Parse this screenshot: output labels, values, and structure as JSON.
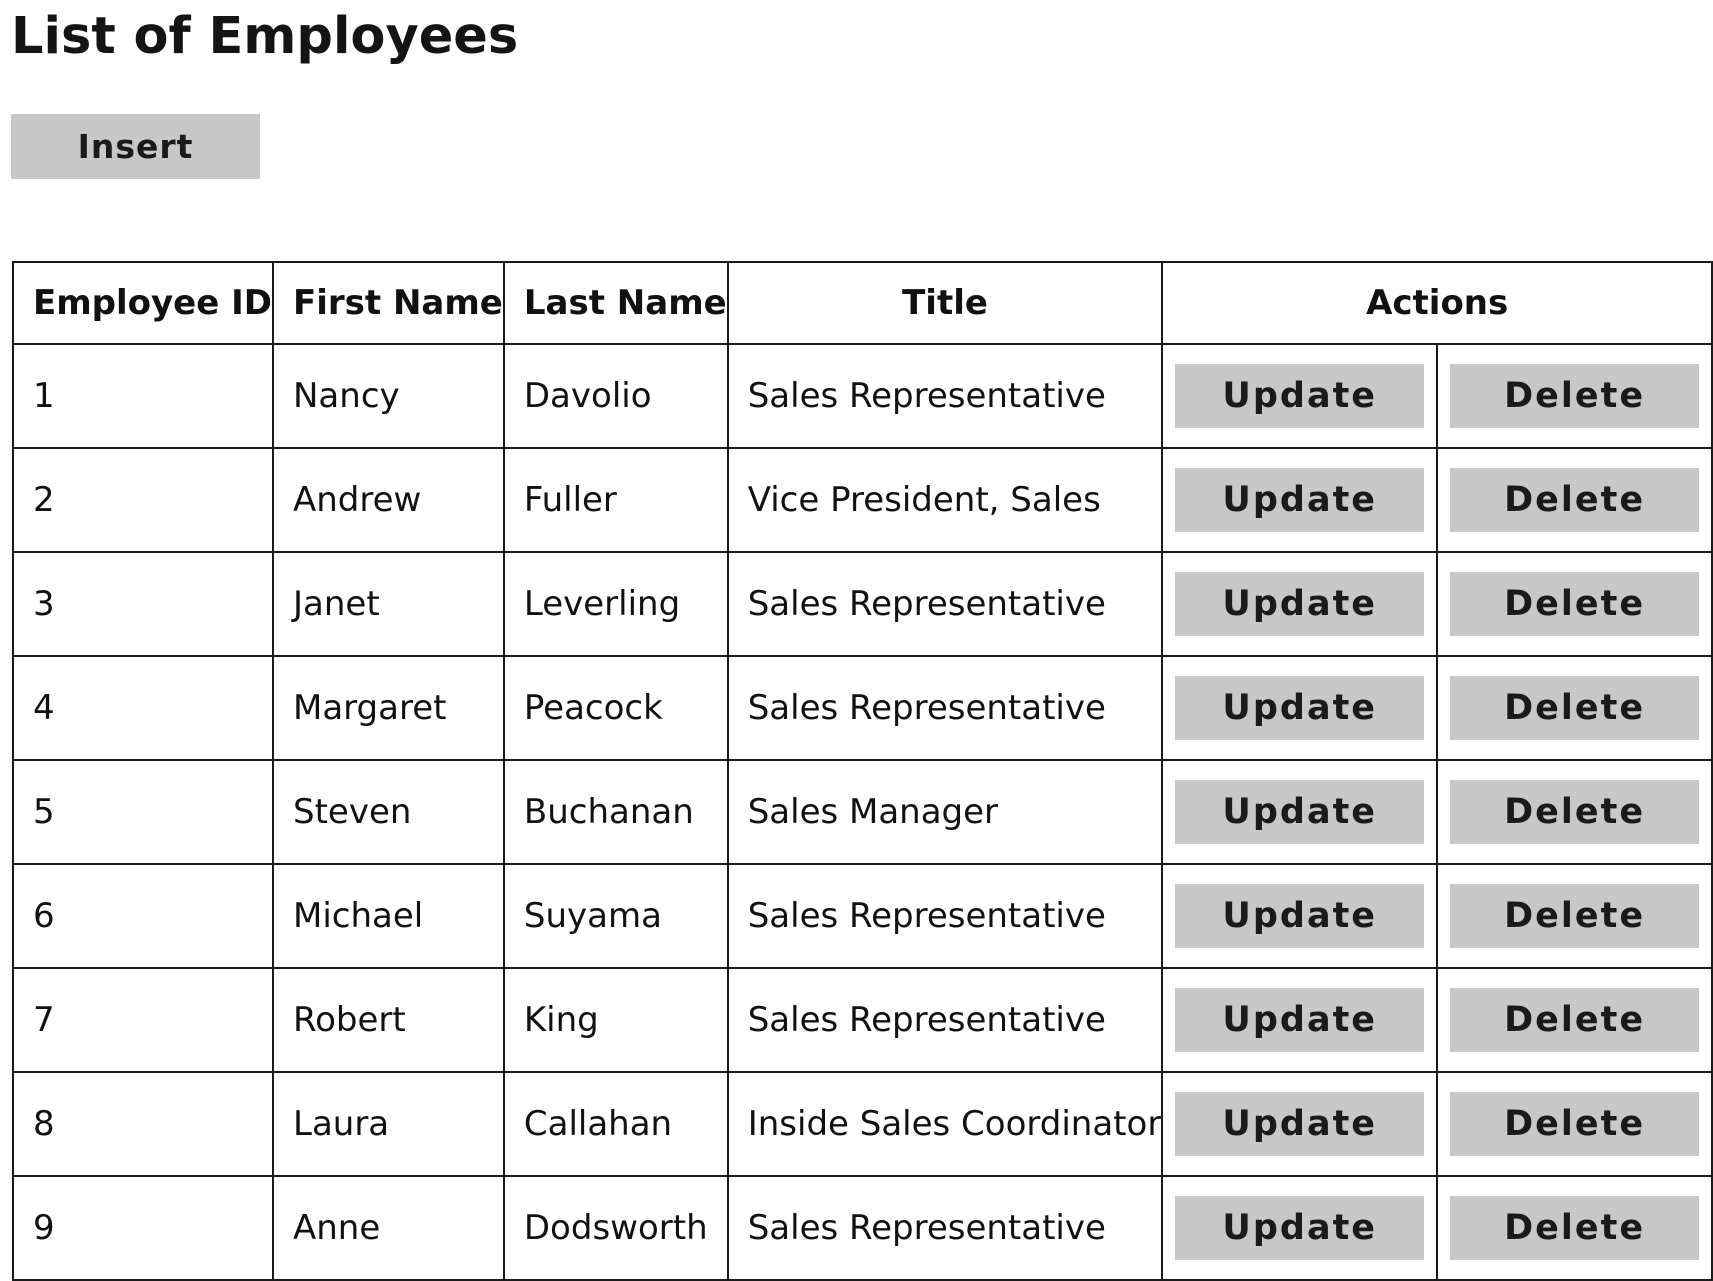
{
  "page": {
    "title": "List of Employees",
    "insert_label": "Insert"
  },
  "table": {
    "headers": {
      "employee_id": "Employee ID",
      "first_name": "First Name",
      "last_name": "Last Name",
      "title": "Title",
      "actions": "Actions"
    },
    "update_label": "Update",
    "delete_label": "Delete",
    "rows": [
      {
        "id": "1",
        "first": "Nancy",
        "last": "Davolio",
        "title": "Sales Representative"
      },
      {
        "id": "2",
        "first": "Andrew",
        "last": "Fuller",
        "title": "Vice President, Sales"
      },
      {
        "id": "3",
        "first": "Janet",
        "last": "Leverling",
        "title": "Sales Representative"
      },
      {
        "id": "4",
        "first": "Margaret",
        "last": "Peacock",
        "title": "Sales Representative"
      },
      {
        "id": "5",
        "first": "Steven",
        "last": "Buchanan",
        "title": "Sales Manager"
      },
      {
        "id": "6",
        "first": "Michael",
        "last": "Suyama",
        "title": "Sales Representative"
      },
      {
        "id": "7",
        "first": "Robert",
        "last": "King",
        "title": "Sales Representative"
      },
      {
        "id": "8",
        "first": "Laura",
        "last": "Callahan",
        "title": "Inside Sales Coordinator"
      },
      {
        "id": "9",
        "first": "Anne",
        "last": "Dodsworth",
        "title": "Sales Representative"
      }
    ]
  },
  "colors": {
    "button_bg": "#c8c8c8",
    "border": "#1a1a1a",
    "text": "#111111"
  }
}
